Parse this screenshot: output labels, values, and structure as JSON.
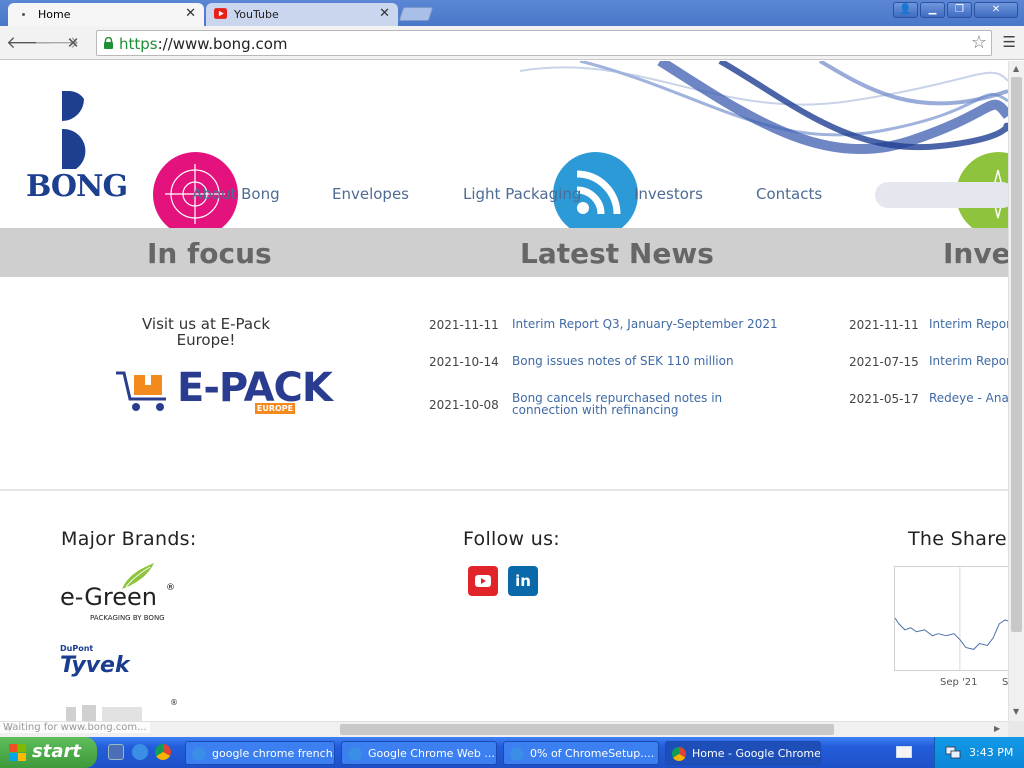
{
  "browser": {
    "tabs": [
      {
        "label": "Home",
        "active": true
      },
      {
        "label": "YouTube",
        "active": false
      }
    ],
    "url_scheme": "https",
    "url_rest": "://www.bong.com",
    "status_text": "Waiting for www.bong.com...",
    "window_buttons": [
      "user",
      "minimize",
      "restore",
      "close"
    ]
  },
  "site": {
    "logo_text": "BONG",
    "nav": [
      "About Bong",
      "Envelopes",
      "Light Packaging",
      "Investors",
      "Contacts"
    ],
    "sections": {
      "focus": "In focus",
      "news": "Latest News",
      "investors": "Inves"
    },
    "focus": {
      "text": "Visit us at E-Pack Europe!",
      "logo_word": "E-PACK",
      "logo_tag": "EUROPE"
    },
    "news": [
      {
        "date": "2021-11-11",
        "title": "Interim Report Q3, January-September 2021"
      },
      {
        "date": "2021-10-14",
        "title": "Bong issues notes of SEK 110 million"
      },
      {
        "date": "2021-10-08",
        "title": "Bong cancels repurchased notes in connection with refinancing"
      }
    ],
    "investor_news": [
      {
        "date": "2021-11-11",
        "title": "Interim Report"
      },
      {
        "date": "2021-07-15",
        "title": "Interim Report"
      },
      {
        "date": "2021-05-17",
        "title": "Redeye - Ana"
      }
    ],
    "footer": {
      "brands_title": "Major Brands:",
      "follow_title": "Follow us:",
      "share_title": "The Share",
      "brand_egreen": "e-Green",
      "brand_egreen_sub": "PACKAGING BY BONG",
      "brand_dupont": "DuPont",
      "brand_tyvek": "Tyvek",
      "share_ticks": [
        "Sep '21",
        "S"
      ]
    },
    "colors": {
      "pink": "#e4127d",
      "blue": "#2c9ad6",
      "green": "#8ec43d",
      "link": "#3f6aa6",
      "brand_navy": "#1d3f8f"
    }
  },
  "taskbar": {
    "start_label": "start",
    "tasks": [
      {
        "label": "google chrome french...",
        "icon": "ie-icon"
      },
      {
        "label": "Google Chrome Web ...",
        "icon": "ie-icon"
      },
      {
        "label": "0% of ChromeSetup....",
        "icon": "ie-icon"
      },
      {
        "label": "Home - Google Chrome",
        "icon": "chrome-icon",
        "active": true
      }
    ],
    "clock": "3:43 PM"
  }
}
